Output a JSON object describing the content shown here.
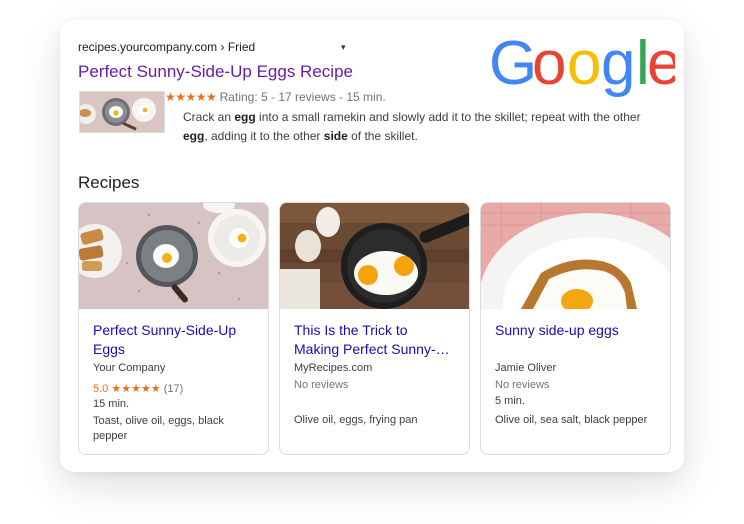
{
  "result": {
    "breadcrumb": "recipes.yourcompany.com › Fried",
    "menu_icon": "▾",
    "title": "Perfect Sunny-Side-Up Eggs Recipe",
    "stars": "★★★★★",
    "rating_text": "Rating: 5 - 17 reviews - 15 min.",
    "snippet": [
      {
        "t": "Crack an ",
        "b": false
      },
      {
        "t": "egg",
        "b": true
      },
      {
        "t": " into a small ramekin and slowly add it to the skillet; repeat with the other ",
        "b": false
      },
      {
        "t": "egg",
        "b": true
      },
      {
        "t": ", adding it to the other ",
        "b": false
      },
      {
        "t": "side",
        "b": true
      },
      {
        "t": " of the skillet.",
        "b": false
      }
    ]
  },
  "logo": {
    "letters": [
      "G",
      "o",
      "o",
      "g",
      "l",
      "e"
    ],
    "colors": [
      "#4285F4",
      "#EA4335",
      "#FBBC05",
      "#4285F4",
      "#34A853",
      "#EA4335"
    ]
  },
  "recipes": {
    "heading": "Recipes",
    "cards": [
      {
        "title_line1": "Perfect Sunny-Side-Up",
        "title_line2": "Eggs",
        "source": "Your Company",
        "rating": "5.0",
        "stars": "★★★★★",
        "reviews": "(17)",
        "time": "15 min.",
        "ingredients": "Toast, olive oil, eggs, black pepper"
      },
      {
        "title_line1": "This Is the Trick to",
        "title_line2": "Making Perfect Sunny-…",
        "source": "MyRecipes.com",
        "reviews": "No reviews",
        "ingredients": "Olive oil, eggs, frying pan"
      },
      {
        "title_line1": "Sunny side-up eggs",
        "source": "Jamie Oliver",
        "reviews": "No reviews",
        "time": "5 min.",
        "ingredients": "Olive oil, sea salt, black pepper"
      }
    ]
  }
}
